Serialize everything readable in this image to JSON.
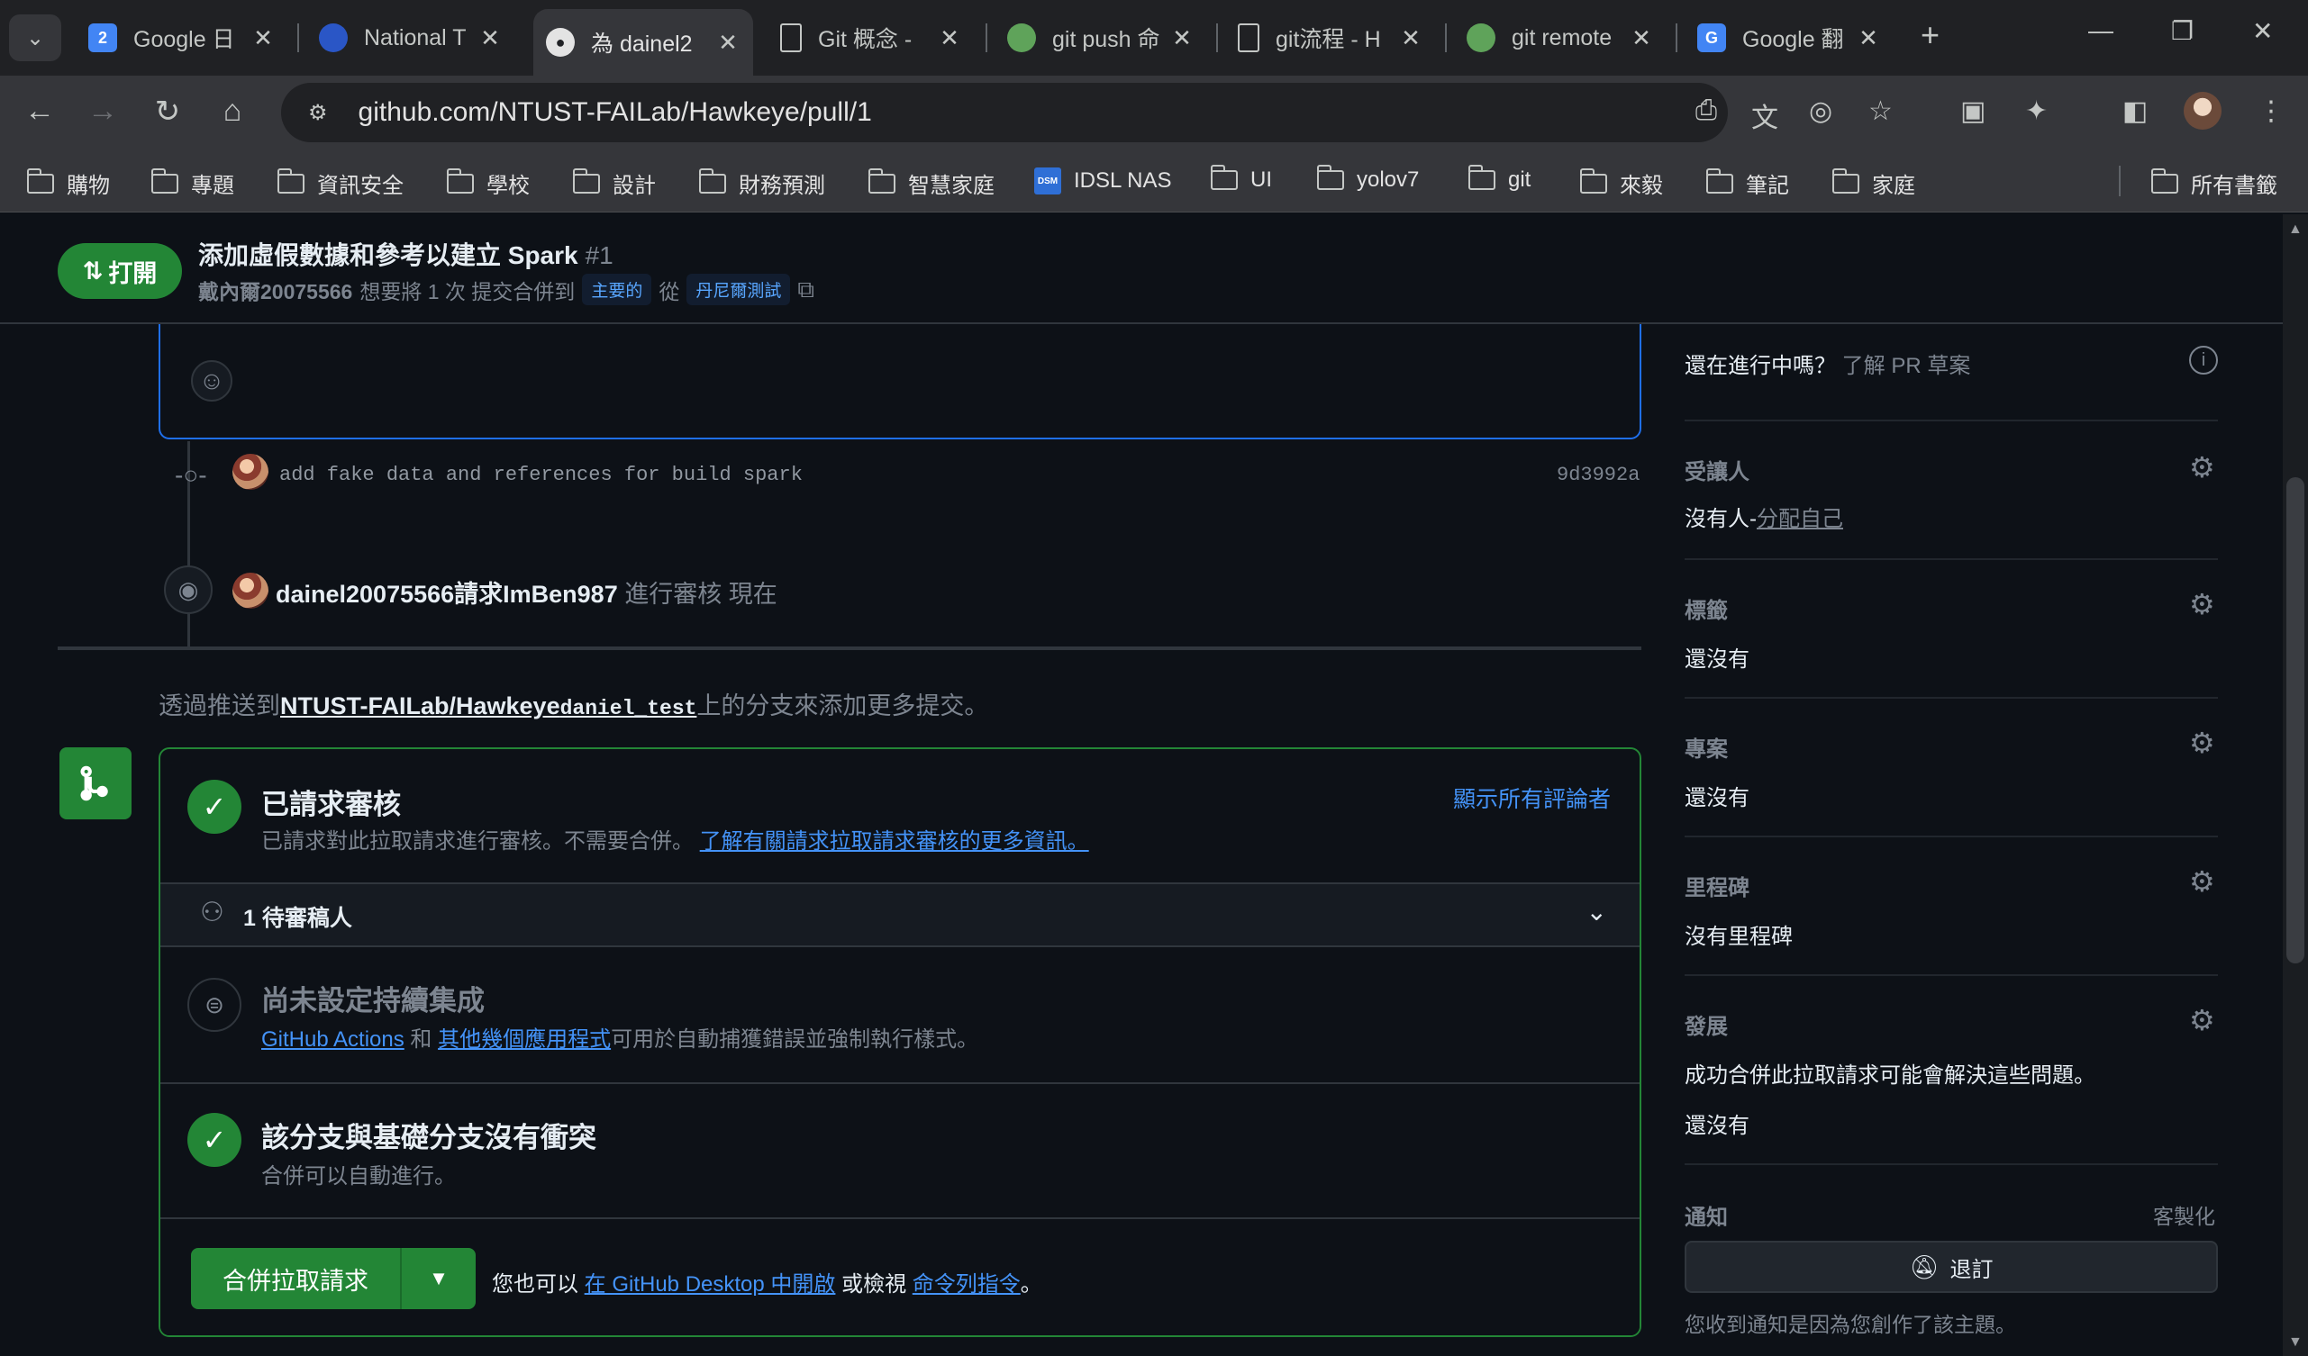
{
  "browser": {
    "tabs": [
      {
        "title": "Google 日",
        "icon": "google-calendar-icon",
        "icon_text": "2",
        "active": false
      },
      {
        "title": "National T",
        "icon": "ntust-icon",
        "icon_text": "",
        "active": false
      },
      {
        "title": "為 dainel2",
        "icon": "github-icon",
        "icon_text": "",
        "active": true
      },
      {
        "title": "Git 概念 -",
        "icon": "document-icon",
        "icon_text": "",
        "active": false
      },
      {
        "title": "git push 命",
        "icon": "chatgpt-icon",
        "icon_text": "",
        "active": false
      },
      {
        "title": "git流程 - H",
        "icon": "document-icon",
        "icon_text": "",
        "active": false
      },
      {
        "title": "git remote",
        "icon": "chatgpt-icon",
        "icon_text": "",
        "active": false
      },
      {
        "title": "Google 翻",
        "icon": "google-translate-icon",
        "icon_text": "G",
        "active": false
      }
    ],
    "url": "github.com/NTUST-FAILab/Hawkeye/pull/1",
    "bookmarks": [
      {
        "label": "購物",
        "icon": "folder-icon"
      },
      {
        "label": "專題",
        "icon": "folder-icon"
      },
      {
        "label": "資訊安全",
        "icon": "folder-icon"
      },
      {
        "label": "學校",
        "icon": "folder-icon"
      },
      {
        "label": "設計",
        "icon": "folder-icon"
      },
      {
        "label": "財務預測",
        "icon": "folder-icon"
      },
      {
        "label": "智慧家庭",
        "icon": "folder-icon"
      },
      {
        "label": "IDSL NAS",
        "icon": "dsm-icon"
      },
      {
        "label": "UI",
        "icon": "folder-icon"
      },
      {
        "label": "yolov7",
        "icon": "folder-icon"
      },
      {
        "label": "git",
        "icon": "folder-icon"
      },
      {
        "label": "來毅",
        "icon": "folder-icon"
      },
      {
        "label": "筆記",
        "icon": "folder-icon"
      },
      {
        "label": "家庭",
        "icon": "folder-icon"
      }
    ],
    "all_bookmarks": "所有書籤"
  },
  "pr": {
    "state": "打開",
    "title": "添加虛假數據和參考以建立 Spark",
    "number": "#1",
    "author": "戴內爾20075566",
    "sub_text": "想要將 1 次 提交合併到",
    "base_branch": "主要的",
    "from_text": "從",
    "head_branch": "丹尼爾測試"
  },
  "timeline": {
    "commit_message": "add fake data and references for build spark",
    "commit_sha": "9d3992a",
    "review_request_actor": "dainel20075566請求ImBen987",
    "review_request_text": "進行審核 現在",
    "push_hint_prefix": "透過推送到",
    "push_repo": "NTUST-FAILab/Hawkeye",
    "push_branch": "daniel_test",
    "push_hint_suffix": "上的分支來添加更多提交。"
  },
  "merge": {
    "review_title": "已請求審核",
    "review_sub": "已請求對此拉取請求進行審核。不需要合併。",
    "review_link": "了解有關請求拉取請求審核的更多資訊。",
    "show_reviewers": "顯示所有評論者",
    "pending_reviewers": "1 待審稿人",
    "ci_title": "尚未設定持續集成",
    "ci_link1": "GitHub Actions",
    "ci_and": "和",
    "ci_link2": "其他幾個應用程式",
    "ci_suffix": "可用於自動捕獲錯誤並強制執行樣式。",
    "conflict_title": "該分支與基礎分支沒有衝突",
    "conflict_sub": "合併可以自動進行。",
    "merge_button": "合併拉取請求",
    "alt_prefix": "您也可以",
    "alt_link1": "在 GitHub Desktop 中開啟",
    "alt_mid": "或檢視",
    "alt_link2": "命令列指令",
    "alt_suffix": "。"
  },
  "sidebar": {
    "draft_question": "還在進行中嗎？",
    "draft_link": "了解 PR 草案",
    "assignees_label": "受讓人",
    "assignees_value": "沒有人-",
    "assign_self": "分配自己",
    "labels_label": "標籤",
    "labels_value": "還沒有",
    "projects_label": "專案",
    "projects_value": "還沒有",
    "milestone_label": "里程碑",
    "milestone_value": "沒有里程碑",
    "development_label": "發展",
    "development_desc": "成功合併此拉取請求可能會解決這些問題。",
    "development_value": "還沒有",
    "notifications_label": "通知",
    "customize": "客製化",
    "unsubscribe": "退訂",
    "notify_reason": "您收到通知是因為您創作了該主題。"
  },
  "colors": {
    "accent_green": "#238636",
    "link_blue": "#4493f8",
    "bg": "#0d1117",
    "border": "#30363d"
  }
}
